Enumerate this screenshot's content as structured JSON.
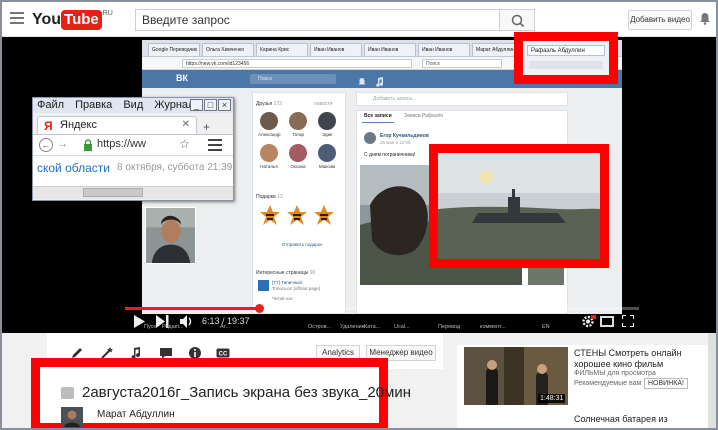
{
  "header": {
    "logo_you": "You",
    "logo_tube": "Tube",
    "logo_region": "RU",
    "search_placeholder": "Введите запрос",
    "upload_label": "Добавить видео"
  },
  "browser_in_video": {
    "tabs": [
      "Google Переводчик",
      "Ольга Химченко",
      "Карина Крис",
      "Иван Иванов",
      "Иван Иванов",
      "Иван Иванов",
      "Марат Абдуллин"
    ],
    "url": "https://new.vk.com/id123456",
    "search_placeholder": "Поиск",
    "highlighted_tab": "Рафаэль Абдуллин"
  },
  "vk": {
    "logo": "ВК",
    "search_placeholder": "Поиск",
    "friends_label": "Друзья",
    "friends_count": "172",
    "friends_extra": "новости",
    "friends": [
      {
        "name": "Александр",
        "color": "#6c5a4a"
      },
      {
        "name": "Татар",
        "color": "#8a6b55"
      },
      {
        "name": "Эдик",
        "color": "#3f4650"
      },
      {
        "name": "Наталья",
        "color": "#b9845f"
      },
      {
        "name": "Оксана",
        "color": "#a35c62"
      },
      {
        "name": "Максим",
        "color": "#4d5e74"
      }
    ],
    "gifts_label": "Подарки",
    "gifts_count": "13",
    "gift_button": "Отправить подарок",
    "pages_label": "Интересные страницы",
    "pages_count": "90",
    "pages": [
      {
        "line1": "[ТТ] Типичный",
        "line2": "Тобольск! [official page]"
      },
      {
        "line1": "Читай нас",
        "line2": ""
      }
    ],
    "compose_placeholder": "Добавить запись...",
    "tab_all": "Все записи",
    "tab_person": "Записи Рафаэля",
    "post_author": "Егор Кучкильдинов",
    "post_date": "26 мая в 12:05",
    "post_text": "С днем пограничника!"
  },
  "overlay_window": {
    "menu": [
      "Файл",
      "Правка",
      "Вид",
      "Журнал"
    ],
    "tab_title": "Яндекс",
    "url": "https://ww",
    "region_text": "ской области",
    "datetime_text": "8 октября, суббота 21:39"
  },
  "player": {
    "time": "6:13 / 19:37",
    "progress": 0.26,
    "taskbar_items": [
      "Пуск",
      "Редакт...",
      "Ат...",
      "Остров...",
      "Удаление",
      "Ката...",
      "Ucal...",
      "Перевод",
      "коммент...",
      "EN"
    ]
  },
  "actions": {
    "analytics_label": "Analytics",
    "manager_label": "Менеджер видео"
  },
  "video": {
    "title": "2августа2016г_Запись экрана без звука_20мин",
    "channel": "Марат Абдуллин"
  },
  "sidebar": {
    "rec_title": "СТЕНЫ Смотреть онлайн хорошее кино фильм",
    "rec_channel": "ФИЛЬМЫ для просмотра",
    "rec_desc": "Рекомендуемые вам",
    "rec_badge": "НОВИНКА!",
    "rec_duration": "1:48:31",
    "rec2_title": "Солнечная батарея из"
  },
  "colors": {
    "highlight": "#ff0000",
    "youtube_red": "#e62117",
    "vk_blue": "#4a76a8"
  }
}
